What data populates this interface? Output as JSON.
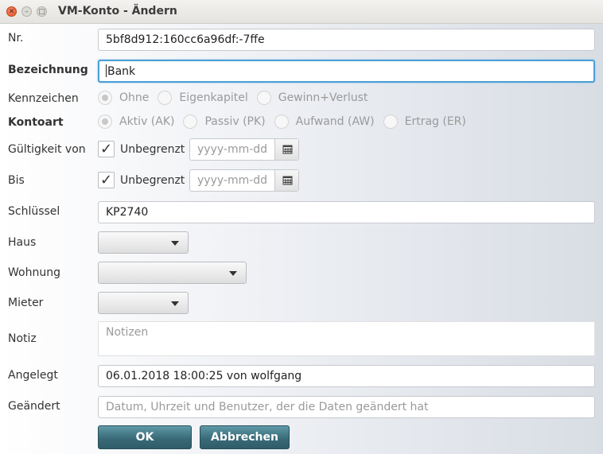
{
  "window": {
    "title": "VM-Konto - Ändern"
  },
  "fields": {
    "nr": {
      "label": "Nr.",
      "value": "5bf8d912:160cc6a96df:-7ffe"
    },
    "bezeichnung": {
      "label": "Bezeichnung",
      "value": "Bank"
    },
    "kennzeichen": {
      "label": "Kennzeichen",
      "options": [
        "Ohne",
        "Eigenkapitel",
        "Gewinn+Verlust"
      ],
      "selected": "Ohne"
    },
    "kontoart": {
      "label": "Kontoart",
      "options": [
        "Aktiv (AK)",
        "Passiv (PK)",
        "Aufwand (AW)",
        "Ertrag (ER)"
      ],
      "selected": "Aktiv (AK)"
    },
    "gueltigkeit_von": {
      "label": "Gültigkeit von",
      "checkbox_label": "Unbegrenzt",
      "checked": true,
      "date_placeholder": "yyyy-mm-dd"
    },
    "bis": {
      "label": "Bis",
      "checkbox_label": "Unbegrenzt",
      "checked": true,
      "date_placeholder": "yyyy-mm-dd"
    },
    "schluessel": {
      "label": "Schlüssel",
      "value": "KP2740"
    },
    "haus": {
      "label": "Haus",
      "value": ""
    },
    "wohnung": {
      "label": "Wohnung",
      "value": ""
    },
    "mieter": {
      "label": "Mieter",
      "value": ""
    },
    "notiz": {
      "label": "Notiz",
      "placeholder": "Notizen"
    },
    "angelegt": {
      "label": "Angelegt",
      "value": "06.01.2018 18:00:25 von wolfgang"
    },
    "geaendert": {
      "label": "Geändert",
      "placeholder": "Datum, Uhrzeit und Benutzer, der die Daten geändert hat"
    }
  },
  "buttons": {
    "ok": "OK",
    "cancel": "Abbrechen"
  },
  "icons": {
    "close": "close-icon",
    "minimize": "minimize-icon",
    "maximize": "maximize-icon",
    "calendar": "calendar-icon",
    "dropdown": "chevron-down-icon"
  }
}
